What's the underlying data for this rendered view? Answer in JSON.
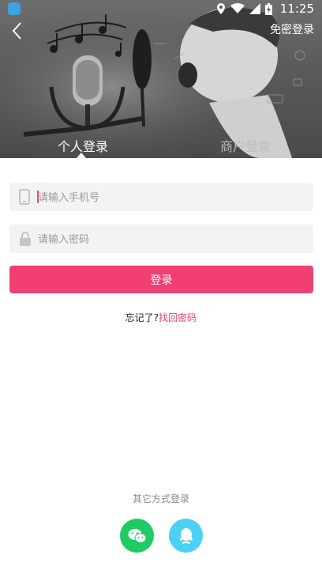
{
  "status_bar": {
    "time": "11:25"
  },
  "header": {
    "free_login": "免密登录"
  },
  "tabs": {
    "personal": "个人登录",
    "merchant": "商户登录"
  },
  "form": {
    "phone_placeholder": "请输入手机号",
    "password_placeholder": "请输入密码",
    "login_label": "登录"
  },
  "forgot": {
    "prefix": "忘记了?",
    "link": "找回密码"
  },
  "other_login": {
    "title": "其它方式登录"
  },
  "colors": {
    "accent": "#f23f72",
    "wechat": "#1fcb63",
    "qq": "#4ad1f3"
  },
  "icons": [
    "back-arrow-icon",
    "phone-icon",
    "lock-icon",
    "wechat-icon",
    "qq-icon"
  ]
}
